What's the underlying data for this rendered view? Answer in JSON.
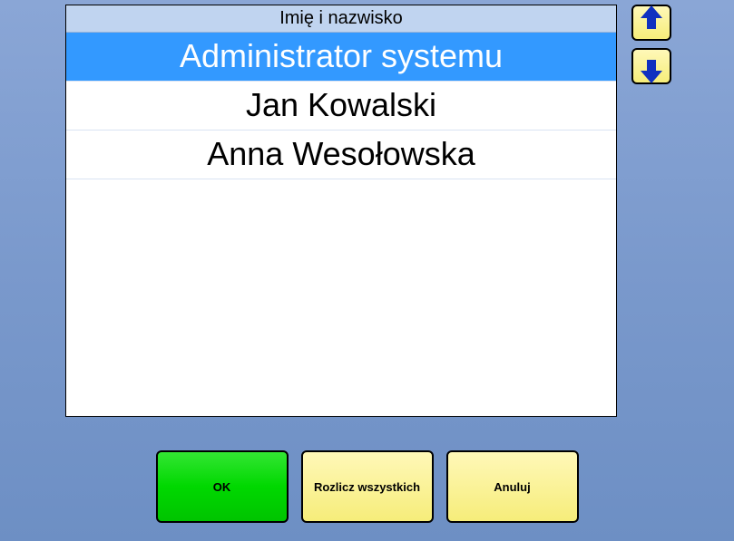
{
  "list": {
    "header": "Imię i nazwisko",
    "rows": [
      {
        "label": "Administrator systemu",
        "selected": true
      },
      {
        "label": "Jan Kowalski",
        "selected": false
      },
      {
        "label": "Anna Wesołowska",
        "selected": false
      }
    ]
  },
  "buttons": {
    "ok": "OK",
    "settle_all": "Rozlicz wszystkich",
    "cancel": "Anuluj"
  }
}
